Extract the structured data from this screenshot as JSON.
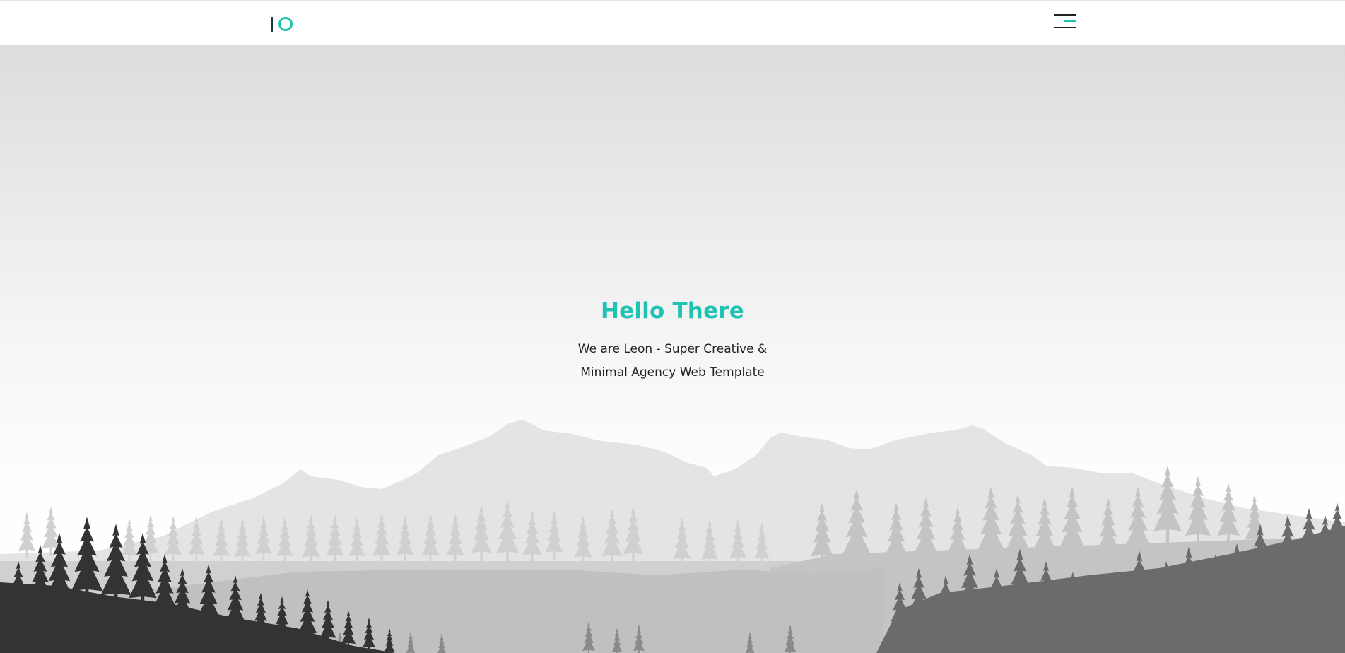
{
  "header": {
    "logo_label": "lo",
    "menu_icon": "hamburger-menu-icon"
  },
  "hero": {
    "title": "Hello There",
    "subtitle_line1": "We are Leon - Super Creative &",
    "subtitle_line2": "Minimal Agency Web Template",
    "background_image": "mountain-forest-landscape"
  },
  "colors": {
    "accent": "#1ec3b3",
    "logo_dark": "#1b3b46",
    "text": "#222222"
  }
}
